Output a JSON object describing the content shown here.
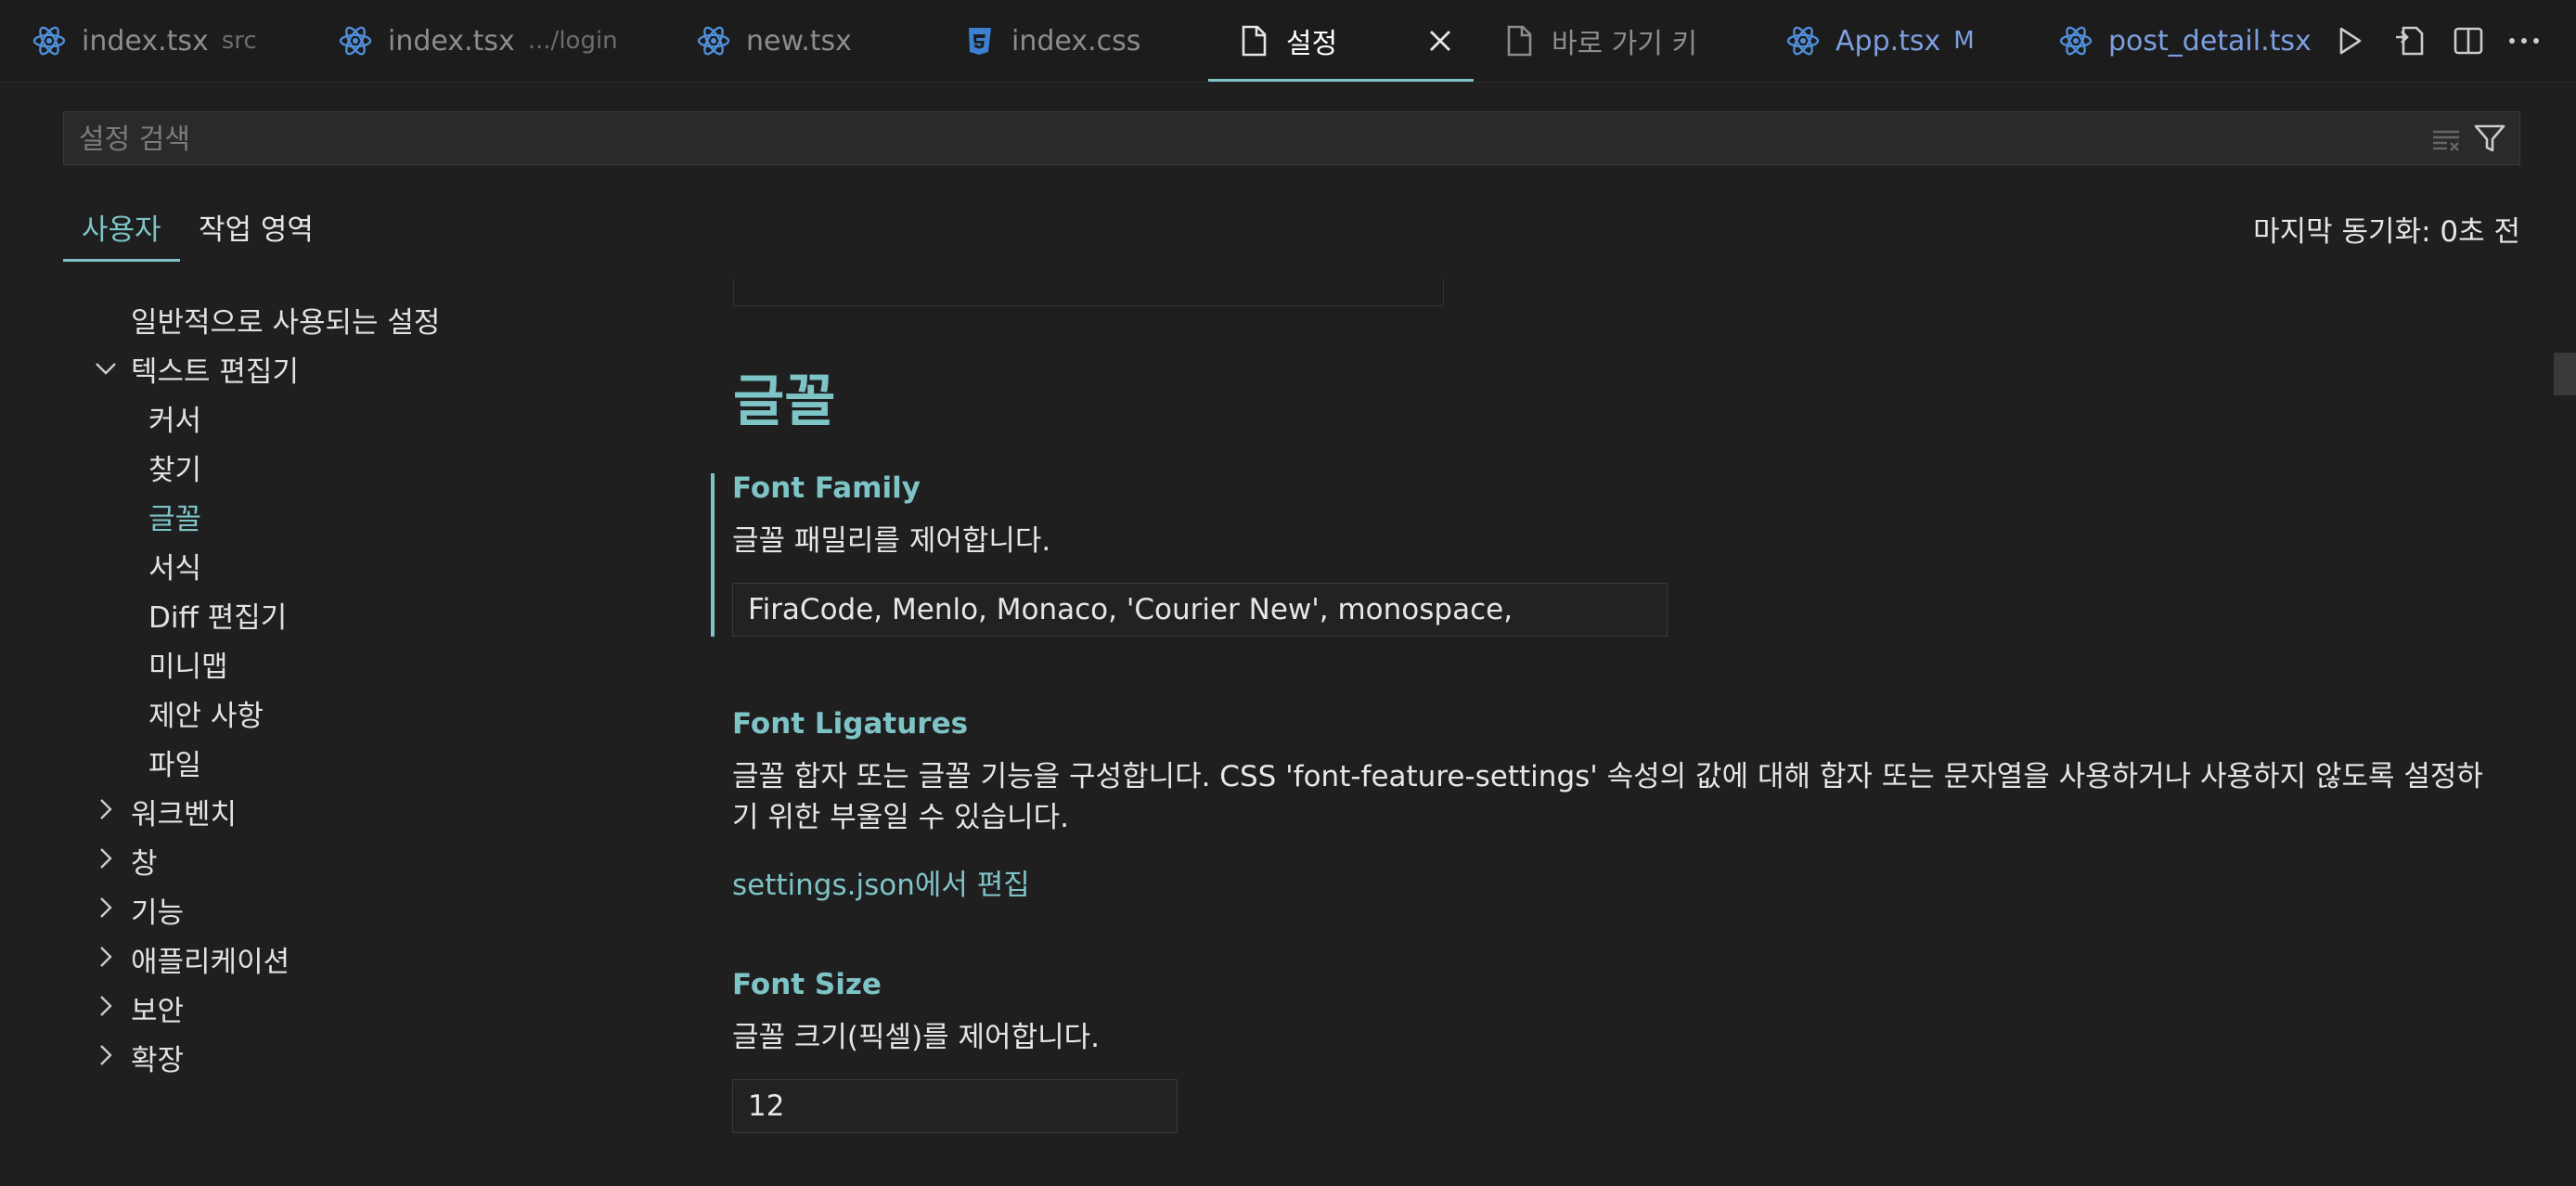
{
  "tabs": [
    {
      "label": "index.tsx",
      "desc": "src",
      "icon": "react-icon"
    },
    {
      "label": "index.tsx",
      "desc": ".../login",
      "icon": "react-icon"
    },
    {
      "label": "new.tsx",
      "desc": "",
      "icon": "react-icon"
    },
    {
      "label": "index.css",
      "desc": "",
      "icon": "css-icon"
    },
    {
      "label": "설정",
      "desc": "",
      "icon": "file-icon"
    },
    {
      "label": "바로 가기 키",
      "desc": "",
      "icon": "file-icon"
    },
    {
      "label": "App.tsx",
      "desc": "M",
      "icon": "react-icon"
    },
    {
      "label": "post_detail.tsx",
      "desc": "",
      "icon": "react-icon"
    }
  ],
  "search": {
    "placeholder": "설정 검색"
  },
  "scopes": {
    "user": "사용자",
    "workspace": "작업 영역"
  },
  "last_sync": "마지막 동기화: 0초 전",
  "toc": [
    {
      "label": "일반적으로 사용되는 설정"
    },
    {
      "label": "텍스트 편집기"
    },
    {
      "label": "커서"
    },
    {
      "label": "찾기"
    },
    {
      "label": "글꼴"
    },
    {
      "label": "서식"
    },
    {
      "label": "Diff 편집기"
    },
    {
      "label": "미니맵"
    },
    {
      "label": "제안 사항"
    },
    {
      "label": "파일"
    },
    {
      "label": "워크벤치"
    },
    {
      "label": "창"
    },
    {
      "label": "기능"
    },
    {
      "label": "애플리케이션"
    },
    {
      "label": "보안"
    },
    {
      "label": "확장"
    }
  ],
  "section": {
    "title": "글꼴"
  },
  "settings": {
    "font_family": {
      "title": "Font Family",
      "desc": "글꼴 패밀리를 제어합니다.",
      "value": "FiraCode, Menlo, Monaco, 'Courier New', monospace,"
    },
    "font_ligatures": {
      "title": "Font Ligatures",
      "desc_line1": "글꼴 합자 또는 글꼴 기능을 구성합니다. CSS 'font-feature-settings' 속성의 값에 대해 합자 또는 문자열을 사용하거나 사용하지 않도록 설정하",
      "desc_line2": "기 위한 부울일 수 있습니다.",
      "link": "settings.json에서 편집"
    },
    "font_size": {
      "title": "Font Size",
      "desc": "글꼴 크기(픽셀)를 제어합니다.",
      "value": "12"
    }
  },
  "colors": {
    "accent": "#7ec4c6",
    "react": "#4f8fd9",
    "css": "#3d7fd1",
    "modified": "#7c9fe0"
  }
}
